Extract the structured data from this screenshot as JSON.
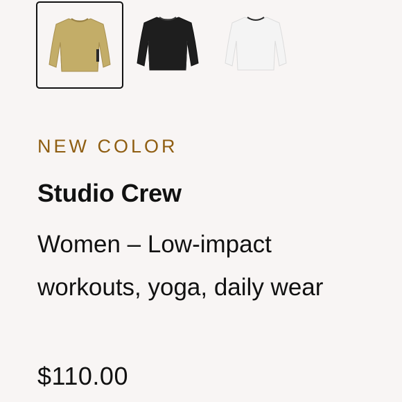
{
  "swatches": [
    {
      "name": "olive-crew",
      "color": "#c3ad68",
      "accent": "#a89050",
      "selected": true
    },
    {
      "name": "black-crew",
      "color": "#1e1e1e",
      "accent": "#111111",
      "selected": false
    },
    {
      "name": "white-crew",
      "color": "#f4f4f4",
      "accent": "#e2e2e2",
      "selected": false
    }
  ],
  "product": {
    "eyebrow": "NEW COLOR",
    "title": "Studio Crew",
    "description": "Women – Low-impact workouts, yoga, daily wear",
    "price": "$110.00"
  },
  "colors": {
    "background": "#f8f5f4",
    "eyebrow": "#8f5e12",
    "text": "#111111"
  }
}
